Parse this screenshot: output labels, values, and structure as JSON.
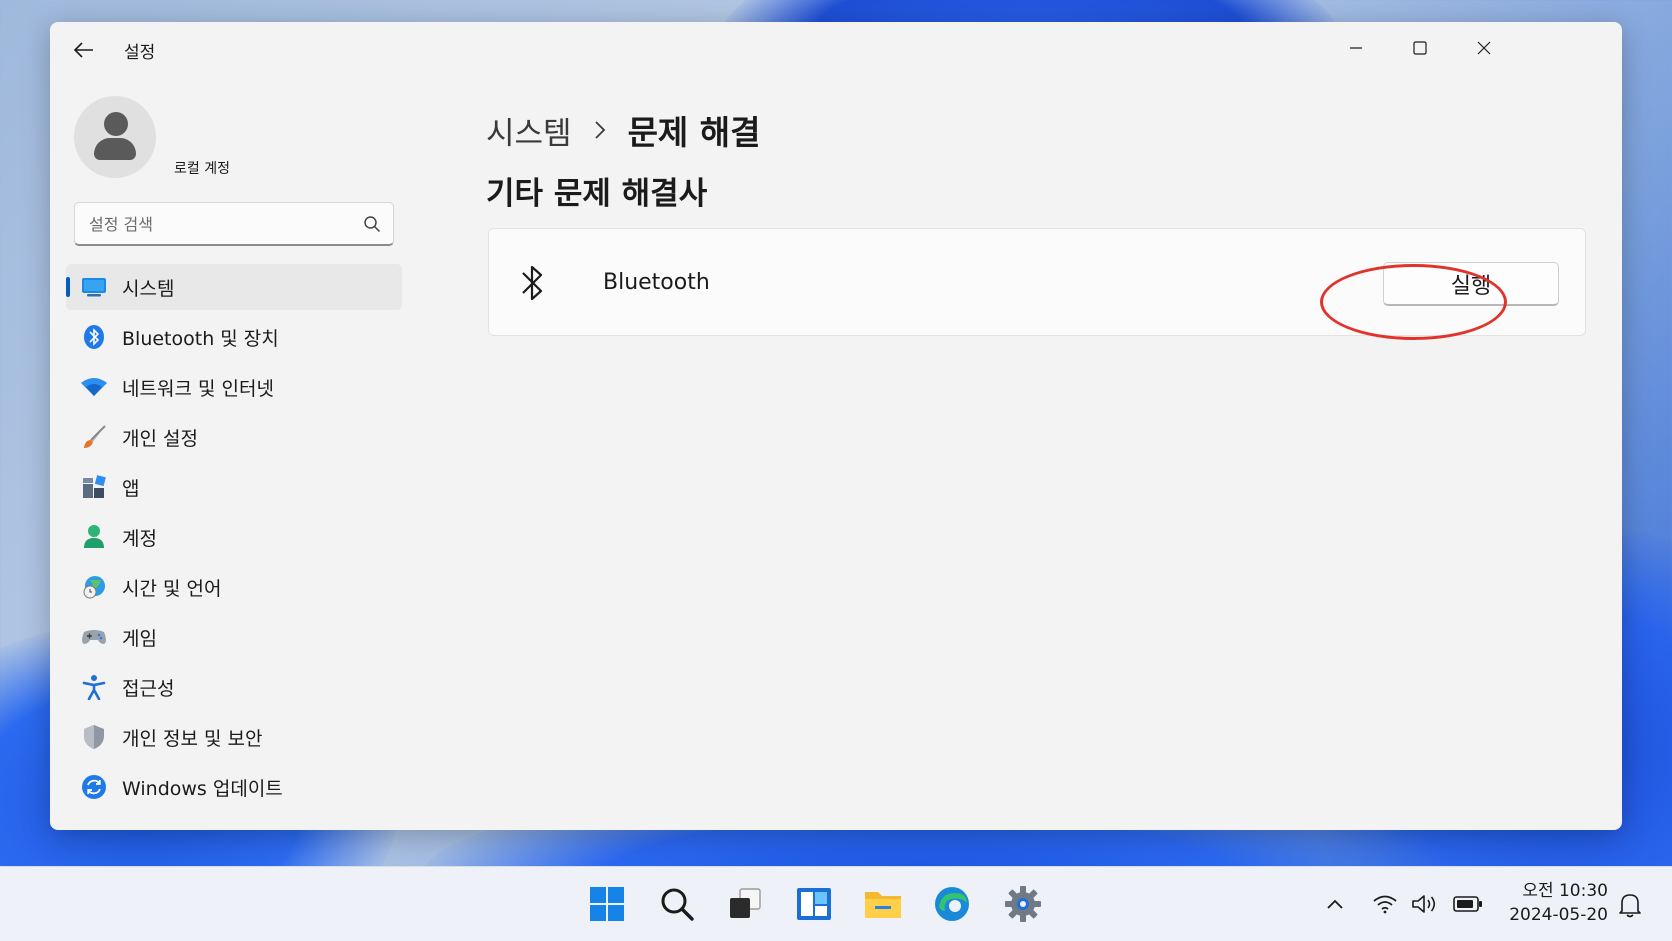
{
  "window": {
    "title": "설정",
    "account": {
      "name": "로컬 계정"
    },
    "search": {
      "placeholder": "설정 검색"
    }
  },
  "sidebar": {
    "items": [
      {
        "label": "시스템",
        "icon": "monitor-icon",
        "selected": true
      },
      {
        "label": "Bluetooth 및 장치",
        "icon": "bluetooth-icon"
      },
      {
        "label": "네트워크 및 인터넷",
        "icon": "wifi-icon"
      },
      {
        "label": "개인 설정",
        "icon": "paintbrush-icon"
      },
      {
        "label": "앱",
        "icon": "apps-icon"
      },
      {
        "label": "계정",
        "icon": "person-icon"
      },
      {
        "label": "시간 및 언어",
        "icon": "globe-clock-icon"
      },
      {
        "label": "게임",
        "icon": "gamepad-icon"
      },
      {
        "label": "접근성",
        "icon": "accessibility-icon"
      },
      {
        "label": "개인 정보 및 보안",
        "icon": "shield-icon"
      },
      {
        "label": "Windows 업데이트",
        "icon": "update-icon"
      }
    ]
  },
  "main": {
    "breadcrumb": {
      "parent": "시스템",
      "current": "문제 해결"
    },
    "section_title": "기타 문제 해결사",
    "troubleshooters": [
      {
        "label": "Bluetooth",
        "icon": "bluetooth-icon",
        "button_label": "실행"
      }
    ]
  },
  "taskbar": {
    "apps": [
      "start-icon",
      "search-icon",
      "task-view-icon",
      "widgets-icon",
      "file-explorer-icon",
      "edge-icon",
      "settings-icon"
    ],
    "clock": {
      "time": "오전 10:30",
      "date": "2024-05-20"
    }
  },
  "colors": {
    "accent": "#005fb8",
    "highlight": "#e0332b"
  }
}
